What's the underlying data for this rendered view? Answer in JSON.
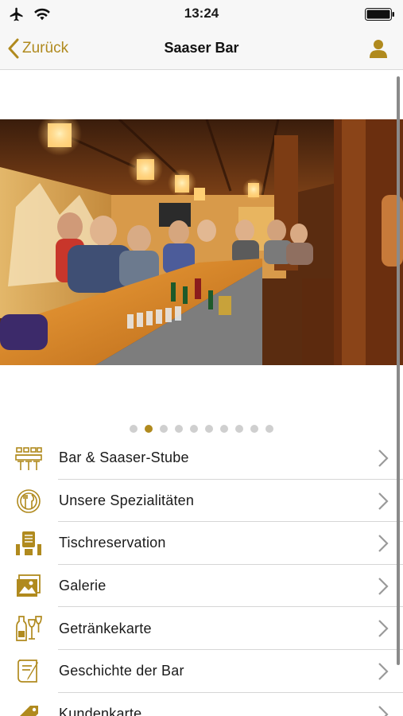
{
  "status": {
    "time": "13:24"
  },
  "nav": {
    "back_label": "Zurück",
    "title": "Saaser Bar"
  },
  "carousel": {
    "page_count": 10,
    "active_index": 1
  },
  "menu": [
    {
      "label": "Bar & Saaser-Stube",
      "icon": "bar-stools-icon"
    },
    {
      "label": "Unsere Spezialitäten",
      "icon": "plate-cutlery-icon"
    },
    {
      "label": "Tischreservation",
      "icon": "reservation-icon"
    },
    {
      "label": "Galerie",
      "icon": "gallery-icon"
    },
    {
      "label": "Getränkekarte",
      "icon": "drinks-icon"
    },
    {
      "label": "Geschichte der Bar",
      "icon": "history-scroll-icon"
    },
    {
      "label": "Kundenkarte",
      "icon": "customer-card-tag-icon"
    }
  ],
  "colors": {
    "accent": "#b08a1e",
    "separator": "#d6d6d6",
    "bar_background": "#f7f7f7"
  }
}
